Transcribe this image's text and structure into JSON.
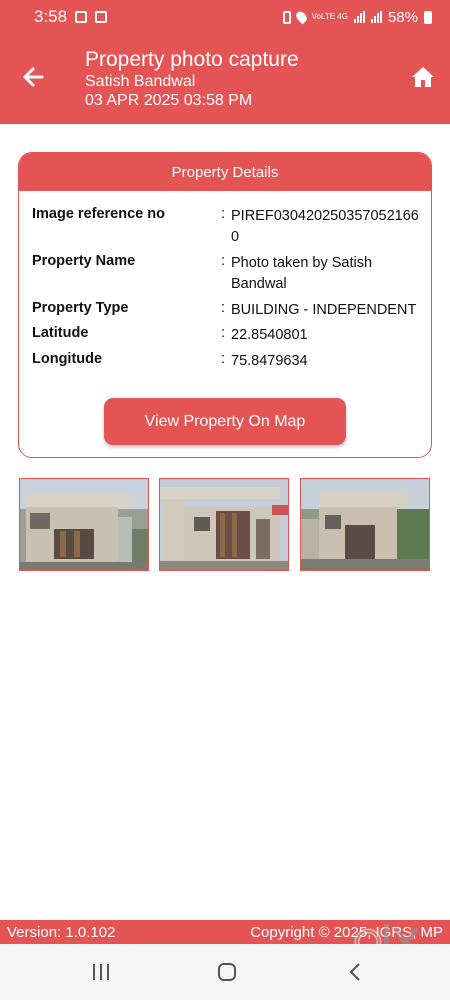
{
  "status_bar": {
    "time": "3:58",
    "network": "VoLTE 4G",
    "battery": "58%"
  },
  "header": {
    "title": "Property photo capture",
    "user": "Satish Bandwal",
    "datetime": "03 APR 2025 03:58 PM"
  },
  "card": {
    "title": "Property Details",
    "rows": [
      {
        "label": "Image reference no",
        "value": "PIREF0304202503570521660"
      },
      {
        "label": "Property Name",
        "value": "Photo taken by Satish Bandwal"
      },
      {
        "label": "Property Type",
        "value": "BUILDING - INDEPENDENT"
      },
      {
        "label": "Latitude",
        "value": "22.8540801"
      },
      {
        "label": "Longitude",
        "value": "75.8479634"
      }
    ],
    "map_button": "View Property On Map"
  },
  "footer": {
    "version": "Version: 1.0.102",
    "copyright": "Copyright © 2025, IGRS, MP"
  },
  "watermark": "OLX",
  "colors": {
    "accent": "#e45454"
  }
}
